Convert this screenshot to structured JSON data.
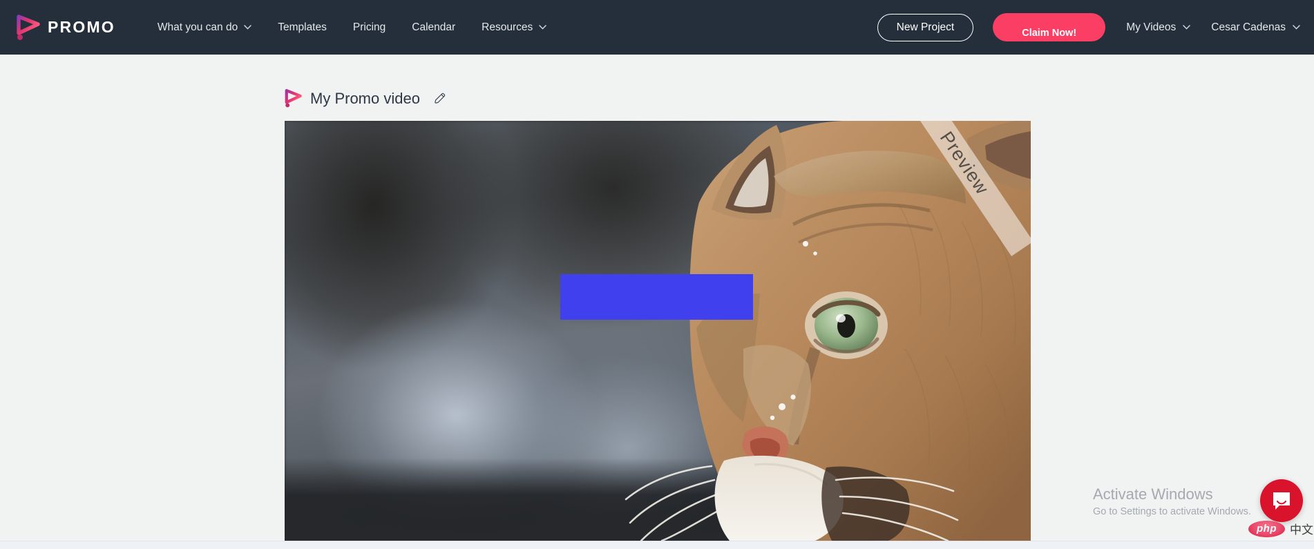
{
  "brand": {
    "name": "PROMO",
    "logo_icon": "promo-play-logo"
  },
  "nav": {
    "links": [
      {
        "label": "What you can do",
        "has_caret": true
      },
      {
        "label": "Templates",
        "has_caret": false
      },
      {
        "label": "Pricing",
        "has_caret": false
      },
      {
        "label": "Calendar",
        "has_caret": false
      },
      {
        "label": "Resources",
        "has_caret": true
      }
    ],
    "new_project_label": "New Project",
    "claim_label": "Claim Now!",
    "my_videos_label": "My Videos",
    "account_label": "Cesar Cadenas"
  },
  "project": {
    "title": "My Promo video",
    "edit_icon": "pencil-icon"
  },
  "video": {
    "watermark_text": "Preview",
    "overlay_color": "#4040ee"
  },
  "windows_watermark": {
    "title": "Activate Windows",
    "subtitle": "Go to Settings to activate Windows."
  },
  "intercom": {
    "icon": "chat-bubble-icon"
  },
  "php_logo": {
    "mark": "php",
    "text": "中文网"
  },
  "colors": {
    "navbar_bg": "#242f3b",
    "page_bg": "#f1f2f2",
    "accent_pink": "#fb3e63",
    "overlay_blue": "#4040ee",
    "intercom_red": "#d8132b"
  }
}
